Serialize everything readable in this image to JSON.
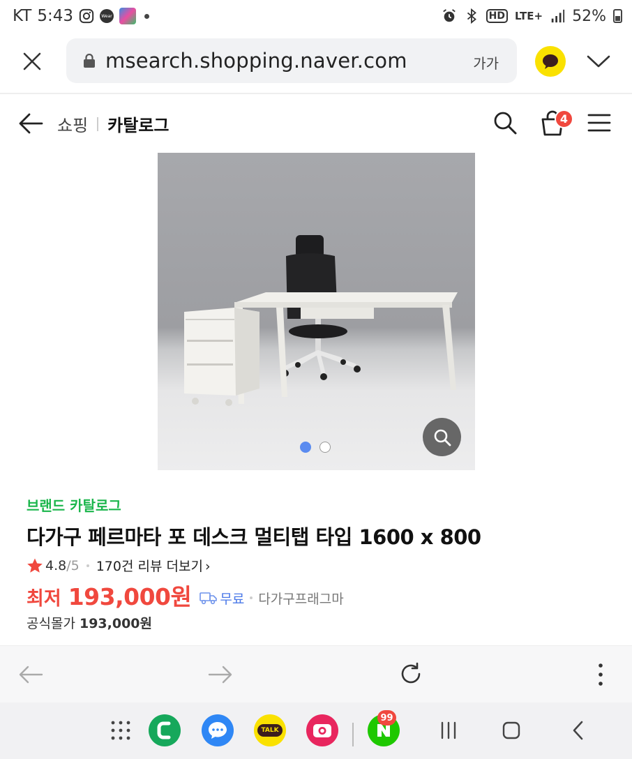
{
  "status_bar": {
    "carrier": "KT",
    "time": "5:43",
    "hd": "HD",
    "network": "LTE+",
    "battery": "52%",
    "wear_icon_text": "Wear"
  },
  "browser": {
    "url": "msearch.shopping.naver.com",
    "text_size_label": "가가"
  },
  "header": {
    "shopping": "쇼핑",
    "catalog": "카탈로그",
    "cart_count": "4"
  },
  "gallery": {
    "current_index": 1,
    "total": 2
  },
  "product": {
    "brand_catalog": "브랜드 카탈로그",
    "title": "다가구 페르마타 포 데스크 멀티탭 타입 1600 x 800",
    "rating": "4.8",
    "rating_max": "/5",
    "reviews": "170건 리뷰 더보기",
    "reviews_chevron": "›",
    "price_label": "최저",
    "price": "193,000원",
    "shipping": "무료",
    "seller": "다가구프래그마",
    "official_label": "공식몰가",
    "official_price": "193,000원"
  },
  "dock": {
    "naver_badge": "99",
    "talk_label": "TALK"
  },
  "colors": {
    "accent_red": "#f0483e",
    "brand_green": "#1bb64c",
    "link_blue": "#4a78e8",
    "kakao_yellow": "#fae100"
  }
}
